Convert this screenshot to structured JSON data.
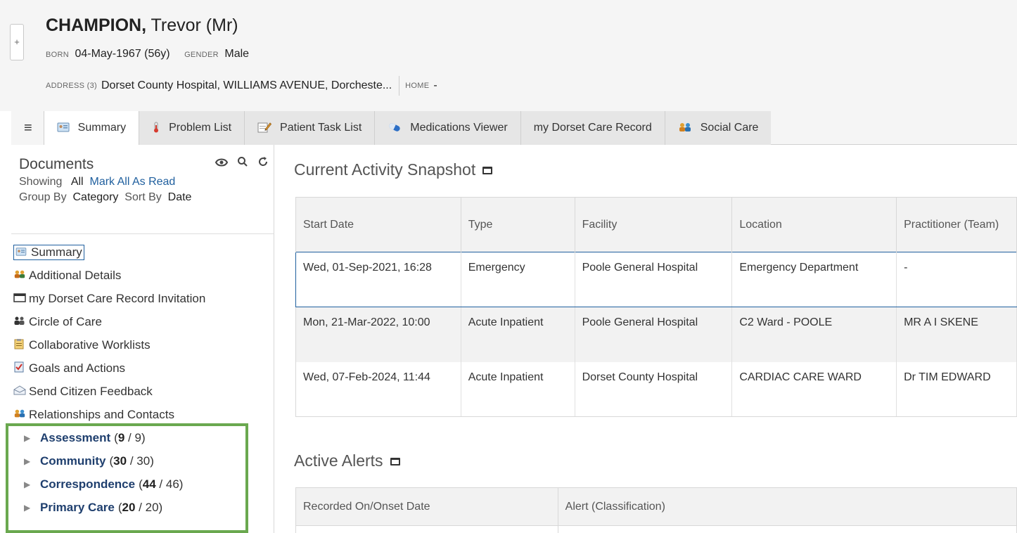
{
  "patient": {
    "surname": "CHAMPION,",
    "given": " Trevor (Mr)",
    "born_label": "BORN",
    "born_value": "04-May-1967 (56y)",
    "gender_label": "GENDER",
    "gender_value": "Male",
    "address_label": "ADDRESS (3)",
    "address_value": "Dorset County Hospital, WILLIAMS AVENUE, Dorcheste...",
    "home_label": "HOME",
    "home_value": "-"
  },
  "tabs": [
    {
      "label": "Summary",
      "icon": "summary-card-icon"
    },
    {
      "label": "Problem List",
      "icon": "thermometer-icon"
    },
    {
      "label": "Patient Task List",
      "icon": "notepad-pencil-icon"
    },
    {
      "label": "Medications Viewer",
      "icon": "pill-icon"
    },
    {
      "label": "my Dorset Care Record",
      "icon": ""
    },
    {
      "label": "Social Care",
      "icon": "people-icon"
    }
  ],
  "sidebar": {
    "title": "Documents",
    "showing_label": "Showing",
    "showing_value": "All",
    "mark_all": "Mark All As Read",
    "group_by_label": "Group By",
    "group_by_value": "Category",
    "sort_by_label": "Sort By",
    "sort_by_value": "Date",
    "items": [
      {
        "label": "Summary",
        "icon": "summary-card-icon"
      },
      {
        "label": "Additional Details",
        "icon": "people-icon"
      },
      {
        "label": "my Dorset Care Record Invitation",
        "icon": "envelope-icon"
      },
      {
        "label": "Circle of Care",
        "icon": "group-icon"
      },
      {
        "label": "Collaborative Worklists",
        "icon": "clipboard-icon"
      },
      {
        "label": "Goals and Actions",
        "icon": "checklist-icon"
      },
      {
        "label": "Send Citizen Feedback",
        "icon": "open-envelope-icon"
      },
      {
        "label": "Relationships and Contacts",
        "icon": "contacts-icon"
      }
    ],
    "groups": [
      {
        "name": "Assessment",
        "unread": "9",
        "total": "9"
      },
      {
        "name": "Community",
        "unread": "30",
        "total": "30"
      },
      {
        "name": "Correspondence",
        "unread": "44",
        "total": "46"
      },
      {
        "name": "Primary Care",
        "unread": "20",
        "total": "20"
      }
    ]
  },
  "snapshot": {
    "title": "Current Activity Snapshot",
    "columns": [
      "Start Date",
      "Type",
      "Facility",
      "Location",
      "Practitioner (Team)"
    ],
    "rows": [
      [
        "Wed, 01-Sep-2021, 16:28",
        "Emergency",
        "Poole General Hospital",
        "Emergency Department",
        "-"
      ],
      [
        "Mon, 21-Mar-2022, 10:00",
        "Acute Inpatient",
        "Poole General Hospital",
        "C2 Ward - POOLE",
        "MR A I SKENE"
      ],
      [
        "Wed, 07-Feb-2024, 11:44",
        "Acute Inpatient",
        "Dorset County Hospital",
        "CARDIAC CARE WARD",
        "Dr TIM EDWARD"
      ]
    ]
  },
  "alerts": {
    "title": "Active Alerts",
    "columns": [
      "Recorded On/Onset Date",
      "Alert (Classification)"
    ]
  }
}
